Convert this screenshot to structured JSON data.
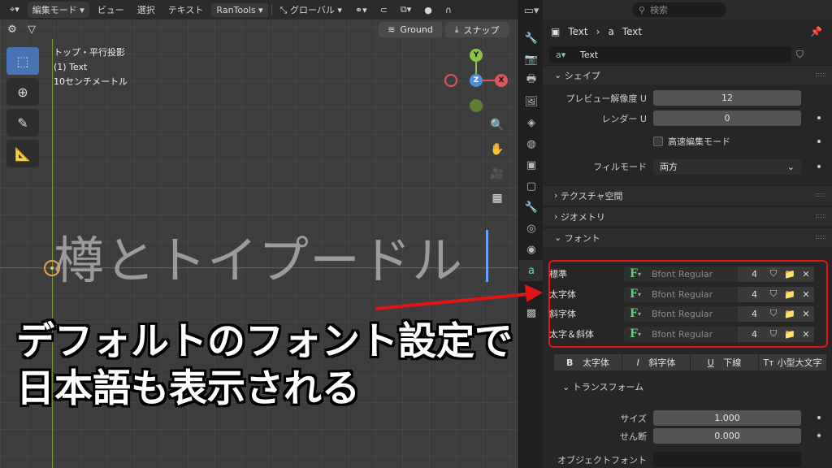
{
  "viewport": {
    "header": {
      "mode": "編集モード",
      "menus": [
        "ビュー",
        "選択",
        "テキスト"
      ],
      "addon": "RanTools",
      "orientation": "グローバル"
    },
    "ground_label": "Ground",
    "snap_label": "スナップ",
    "info": {
      "view": "トップ・平行投影",
      "object": "(1) Text",
      "scale": "10センチメートル"
    },
    "gizmo": {
      "y": "Y",
      "z": "Z",
      "x": "X"
    },
    "text_object": "樽とトイプードル"
  },
  "overlay_caption": {
    "line1": "デフォルトのフォント設定で",
    "line2": "日本語も表示される"
  },
  "properties": {
    "search_placeholder": "検索",
    "breadcrumb": {
      "object": "Text",
      "data": "Text"
    },
    "datablock": "Text",
    "shape": {
      "title": "シェイプ",
      "preview_resolution_label": "プレビュー解像度 U",
      "preview_resolution_value": "12",
      "render_u_label": "レンダー U",
      "render_u_value": "0",
      "fast_edit_label": "高速編集モード",
      "fill_mode_label": "フィルモード",
      "fill_mode_value": "両方"
    },
    "texture_space": "テクスチャ空間",
    "geometry": "ジオメトリ",
    "font": {
      "title": "フォント",
      "rows": [
        {
          "label": "標準",
          "name": "Bfont Regular",
          "users": "4"
        },
        {
          "label": "太字体",
          "name": "Bfont Regular",
          "users": "4"
        },
        {
          "label": "斜字体",
          "name": "Bfont Regular",
          "users": "4"
        },
        {
          "label": "太字＆斜体",
          "name": "Bfont Regular",
          "users": "4"
        }
      ],
      "styles": {
        "bold": "太字体",
        "italic": "斜字体",
        "underline": "下線",
        "smallcaps": "小型大文字"
      }
    },
    "transform": {
      "title": "トランスフォーム",
      "size_label": "サイズ",
      "size_value": "1.000",
      "shear_label": "せん断",
      "shear_value": "0.000",
      "object_font_label": "オブジェクトフォント"
    }
  },
  "colors": {
    "accent": "#4772b3",
    "highlight_box": "#e01515",
    "font_icon": "#5bd177"
  }
}
